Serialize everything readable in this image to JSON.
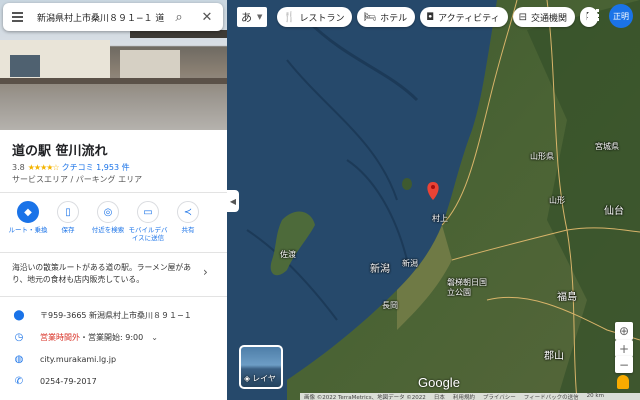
{
  "search": {
    "query": "新潟県村上市桑川８９１−１ 道の駅 笹川流れ"
  },
  "place": {
    "name": "道の駅 笹川流れ",
    "rating": "3.8",
    "stars": "★★★★☆",
    "reviews": "クチコミ 1,953 件",
    "category": "サービスエリア / パーキング エリア",
    "description": "海沿いの散策ルートがある道の駅。ラーメン屋があり、地元の食材も店内販売している。"
  },
  "actions": [
    {
      "label": "ルート・乗換"
    },
    {
      "label": "保存"
    },
    {
      "label": "付近を検索"
    },
    {
      "label": "モバイルデバイスに送信"
    },
    {
      "label": "共有"
    }
  ],
  "info": {
    "address": "〒959-3665 新潟県村上市桑川８９１−１",
    "status_closed": "営業時間外",
    "status_open": "・営業開始: 9:00",
    "website": "city.murakami.lg.jp",
    "phone": "0254-79-2017"
  },
  "map": {
    "lang_label": "あ",
    "chips": [
      {
        "icon": "restaurant-icon",
        "label": "レストラン"
      },
      {
        "icon": "hotel-icon",
        "label": "ホテル"
      },
      {
        "icon": "camera-icon",
        "label": "アクティビティ"
      },
      {
        "icon": "transit-icon",
        "label": "交通機関"
      },
      {
        "icon": "more-icon",
        "label": "["
      }
    ],
    "avatar": "正明",
    "layer_label": "レイヤ",
    "google": "Google",
    "labels": {
      "yamagata_pref": "山形県",
      "miyagi": "宮城県",
      "sendai": "仙台",
      "niigata_big": "新潟",
      "niigata_small": "新潟",
      "sado": "佐渡",
      "fukushima": "福島",
      "koriyama": "郡山",
      "yamagata_city": "山形",
      "murakami": "村上",
      "park": "磐梯朝日国立公園",
      "nagaoka": "長岡"
    },
    "attribution": [
      "画像 ©2022 TerraMetrics、地図データ ©2022",
      "日本",
      "利用規約",
      "プライバシー",
      "フィードバックの送信",
      "20 km"
    ]
  },
  "colors": {
    "accent": "#1a73e8",
    "closed": "#d93025",
    "pin": "#ea4335"
  }
}
